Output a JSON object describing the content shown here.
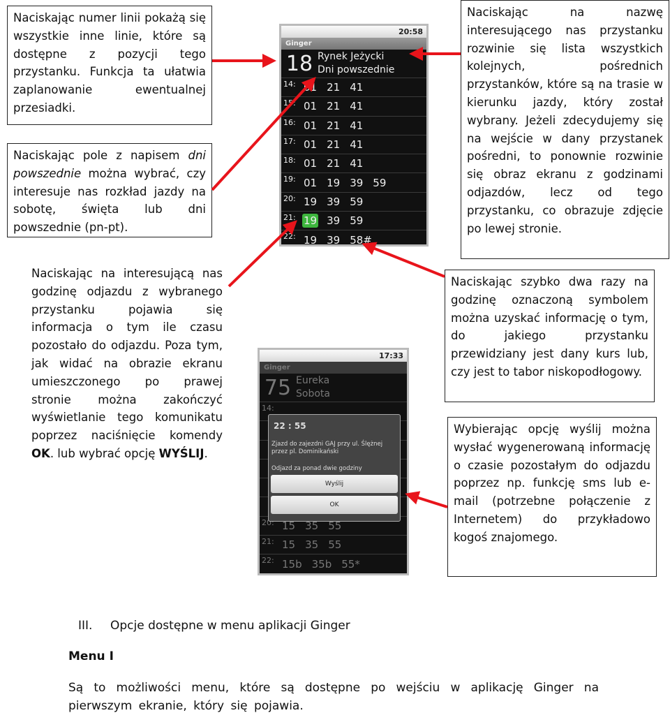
{
  "callouts": {
    "line_numbers": "Naciskając numer linii pokażą się wszystkie inne linie, które są dostępne z pozycji tego przystanku. Funkcja ta ułatwia zaplanowanie ewentualnej przesiadki.",
    "weekdays_pre": "Naciskając pole z napisem ",
    "weekdays_em": "dni powszednie",
    "weekdays_post": " można wybrać, czy interesuje nas rozkład jazdy na sobotę, święta lub dni powszednie (pn-pt).",
    "departure_pre": "Naciskając na interesującą nas godzinę odjazdu z wybranego przystanku pojawia się informacja o tym ile czasu pozostało do odjazdu. Poza tym, jak widać na obrazie ekranu umieszczonego po prawej stronie można zakończyć wyświetlanie tego komunikatu poprzez naciśnięcie komendy ",
    "departure_ok": "OK",
    "departure_mid": ". lub wybrać opcję ",
    "departure_send": "WYŚLIJ",
    "departure_end": ".",
    "stop_name": "Naciskając na nazwę interesującego nas przystanku rozwinie się lista wszystkich kolejnych, pośrednich przystanków, które są na trasie w kierunku jazdy, który został wybrany. Jeżeli zdecydujemy się na wejście w dany przystanek pośredni, to ponownie rozwinie się obraz ekranu z godzinami odjazdów, lecz od tego przystanku, co obrazuje zdjęcie po lewej stronie.",
    "double_tap": "Naciskając szybko dwa razy na godzinę oznaczoną symbolem można uzyskać informację o tym, do jakiego przystanku przewidziany jest dany kurs lub, czy jest to tabor niskopodłogowy.",
    "send_option": "Wybierając opcję wyślij można wysłać wygenerowaną informację o czasie pozostałym do odjazdu poprzez np. funkcję sms lub e-mail (potrzebne połączenie z Internetem) do przykładowo kogoś znajomego."
  },
  "phone1": {
    "time": "20:58",
    "app": "Ginger",
    "line": "18",
    "stop": "Rynek Jeżycki",
    "day": "Dni powszednie",
    "rows": [
      {
        "h": "14:",
        "m": [
          "01",
          "21",
          "41"
        ]
      },
      {
        "h": "15:",
        "m": [
          "01",
          "21",
          "41"
        ]
      },
      {
        "h": "16:",
        "m": [
          "01",
          "21",
          "41"
        ]
      },
      {
        "h": "17:",
        "m": [
          "01",
          "21",
          "41"
        ]
      },
      {
        "h": "18:",
        "m": [
          "01",
          "21",
          "41"
        ]
      },
      {
        "h": "19:",
        "m": [
          "01",
          "19",
          "39",
          "59"
        ]
      },
      {
        "h": "20:",
        "m": [
          "19",
          "39",
          "59"
        ]
      },
      {
        "h": "21:",
        "m": [
          "19",
          "39",
          "59"
        ],
        "sel": 0
      },
      {
        "h": "22:",
        "m": [
          "19",
          "39",
          "58#"
        ]
      }
    ]
  },
  "phone2": {
    "time": "17:33",
    "app": "Ginger",
    "line": "75",
    "stop": "Eureka",
    "day": "Sobota",
    "rows": [
      {
        "h": "14:",
        "m": []
      },
      {
        "h": "",
        "m": []
      },
      {
        "h": "",
        "m": []
      },
      {
        "h": "",
        "m": []
      },
      {
        "h": "",
        "m": []
      },
      {
        "h": "",
        "m": []
      },
      {
        "h": "20:",
        "m": [
          "15",
          "35",
          "55"
        ]
      },
      {
        "h": "21:",
        "m": [
          "15",
          "35",
          "55"
        ]
      },
      {
        "h": "22:",
        "m": [
          "15b",
          "35b",
          "55*"
        ]
      }
    ],
    "dialog": {
      "time": "22 : 55",
      "info": "Zjazd do zajezdni GAJ przy ul. Ślężnej przez pl. Dominikański",
      "remaining": "Odjazd za ponad dwie godziny",
      "send": "Wyślij",
      "ok": "OK"
    }
  },
  "section": {
    "number": "III.",
    "title": "Opcje dostępne w menu aplikacji Ginger",
    "menu_heading": "Menu I",
    "paragraph": "Są to możliwości menu, które są dostępne po wejściu w aplikację Ginger na pierwszym ekranie, który się pojawia."
  },
  "colors": {
    "arrow": "#e8141b",
    "highlight": "#3db53d"
  }
}
